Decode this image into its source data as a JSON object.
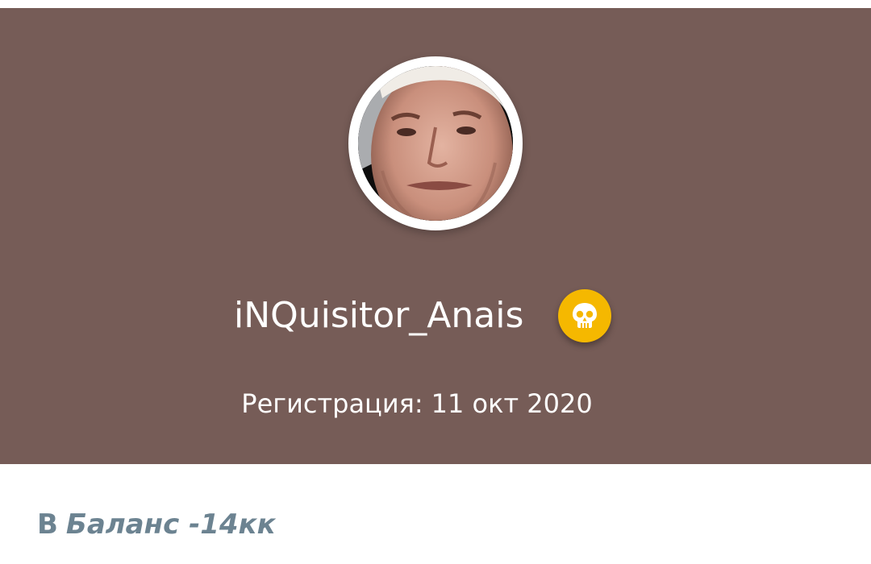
{
  "profile": {
    "username": "iNQuisitor_Anais",
    "registration_label": "Регистрация:",
    "registration_date": "11 окт 2020",
    "avatar_icon": "user-avatar",
    "badge_icon": "skull-icon",
    "badge_color": "#f5b800",
    "header_color": "#765c57"
  },
  "status": {
    "prefix": "В",
    "text": "Баланс -14кк",
    "color": "#6c8391"
  }
}
